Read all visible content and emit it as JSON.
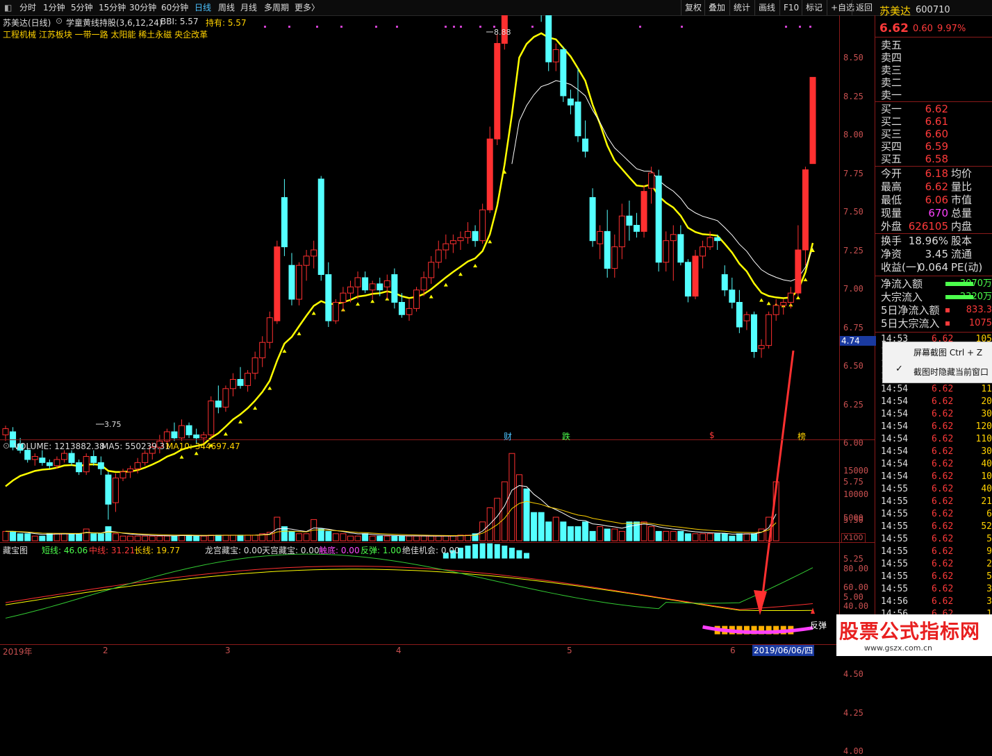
{
  "toolbar": {
    "left": [
      "分时",
      "1分钟",
      "5分钟",
      "15分钟",
      "30分钟",
      "60分钟",
      "日线",
      "周线",
      "月线",
      "多周期",
      "更多〉"
    ],
    "active": "日线",
    "right": [
      "复权",
      "叠加",
      "统计",
      "画线",
      "F10",
      "标记",
      "+自选",
      "返回"
    ]
  },
  "chart_header": {
    "stock": "苏美达(日线)",
    "indicator": "学童黄线持股(3,6,12,24)",
    "bbi": "BBI: 5.57",
    "hold": "持有: 5.57",
    "tags": "工程机械 江苏板块 一带一路 太阳能 稀土永磁 央企改革"
  },
  "price_axis": [
    "8.50",
    "8.25",
    "8.00",
    "7.75",
    "7.50",
    "7.25",
    "7.00",
    "6.75",
    "6.50",
    "6.25",
    "6.00",
    "5.75",
    "5.50",
    "5.25",
    "5.00",
    "4.75",
    "4.50",
    "4.25",
    "4.00"
  ],
  "price_marker": "4.74",
  "chart_labels": {
    "high": "8.88",
    "low": "3.75"
  },
  "event_marks": [
    "财",
    "跌",
    "$",
    "榜"
  ],
  "volume_header": {
    "vol": "VOLUME: 1213882.38",
    "ma5": "MA5: 550239.31",
    "ma10": "MA10: 344697.47"
  },
  "volume_axis": [
    "15000",
    "10000",
    "5000"
  ],
  "volume_unit": "X100",
  "ind_header": {
    "title": "藏宝图",
    "short": "短线: 46.06",
    "mid": "中线: 31.21",
    "long": "长线: 19.77",
    "longgong": "龙宫藏宝: 0.00",
    "tiangong": "天宫藏宝: 0.00",
    "chudi": "触底: 0.00",
    "fantan": "反弹: 1.00",
    "jijia": "绝佳机会: 0.00"
  },
  "ind_axis": [
    "80.00",
    "60.00",
    "40.00"
  ],
  "ind_label": "反弹",
  "date_axis": [
    "2019年",
    "2",
    "3",
    "4",
    "5",
    "6"
  ],
  "date_cursor": "2019/06/06/四",
  "quote": {
    "name": "苏美达",
    "code": "600710",
    "price": "6.62",
    "change": "0.60",
    "pct": "9.97%",
    "sell": [
      "卖五",
      "卖四",
      "卖三",
      "卖二",
      "卖一"
    ],
    "buy": [
      [
        "买一",
        "6.62"
      ],
      [
        "买二",
        "6.61"
      ],
      [
        "买三",
        "6.60"
      ],
      [
        "买四",
        "6.59"
      ],
      [
        "买五",
        "6.58"
      ]
    ],
    "stats": [
      [
        "今开",
        "6.18",
        "均价"
      ],
      [
        "最高",
        "6.62",
        "量比"
      ],
      [
        "最低",
        "6.06",
        "市值"
      ],
      [
        "现量",
        "670",
        "总量"
      ],
      [
        "外盘",
        "626105",
        "内盘"
      ]
    ],
    "stats2": [
      [
        "换手",
        "18.96%",
        "股本"
      ],
      [
        "净资",
        "3.45",
        "流通"
      ],
      [
        "收益(一)",
        "0.064",
        "PE(动)"
      ]
    ],
    "flows": [
      [
        "净流入额",
        "-3070万"
      ],
      [
        "大宗流入",
        "-2320万"
      ],
      [
        "5日净流入额",
        "833.3"
      ],
      [
        "5日大宗流入",
        "1075"
      ]
    ]
  },
  "ticks": [
    [
      "14:53",
      "6.62",
      "105"
    ],
    [
      "14:53",
      "6.62",
      ""
    ],
    [
      "14:53",
      "6.62",
      ""
    ],
    [
      "14:54",
      "6.62",
      ""
    ],
    [
      "14:54",
      "6.62",
      "11"
    ],
    [
      "14:54",
      "6.62",
      "20"
    ],
    [
      "14:54",
      "6.62",
      "30"
    ],
    [
      "14:54",
      "6.62",
      "120"
    ],
    [
      "14:54",
      "6.62",
      "110"
    ],
    [
      "14:54",
      "6.62",
      "30"
    ],
    [
      "14:54",
      "6.62",
      "40"
    ],
    [
      "14:54",
      "6.62",
      "10"
    ],
    [
      "14:55",
      "6.62",
      "40"
    ],
    [
      "14:55",
      "6.62",
      "21"
    ],
    [
      "14:55",
      "6.62",
      "6"
    ],
    [
      "14:55",
      "6.62",
      "52"
    ],
    [
      "14:55",
      "6.62",
      "5"
    ],
    [
      "14:55",
      "6.62",
      "9"
    ],
    [
      "14:55",
      "6.62",
      "2"
    ],
    [
      "14:55",
      "6.62",
      "5"
    ],
    [
      "14:55",
      "6.62",
      "3"
    ],
    [
      "14:56",
      "6.62",
      "3"
    ],
    [
      "14:56",
      "6.62",
      "1"
    ]
  ],
  "context_menu": {
    "screenshot": "屏幕截图  Ctrl + Z",
    "hide": "截图时隐藏当前窗口"
  },
  "watermark": "股票公式指标网",
  "watermark_url": "www.gszx.com.cn",
  "chart_data": {
    "type": "candlestick",
    "price_range": [
      3.75,
      8.88
    ],
    "ohlc": [
      [
        4.3,
        4.36,
        4.26,
        4.34
      ],
      [
        4.32,
        4.35,
        4.2,
        4.22
      ],
      [
        4.24,
        4.28,
        4.18,
        4.2
      ],
      [
        4.2,
        4.22,
        4.12,
        4.14
      ],
      [
        4.14,
        4.18,
        4.1,
        4.16
      ],
      [
        4.15,
        4.2,
        4.1,
        4.12
      ],
      [
        4.12,
        4.14,
        4.08,
        4.1
      ],
      [
        4.1,
        4.16,
        4.08,
        4.14
      ],
      [
        4.14,
        4.2,
        4.12,
        4.18
      ],
      [
        4.18,
        4.2,
        4.1,
        4.12
      ],
      [
        4.12,
        4.14,
        4.04,
        4.06
      ],
      [
        4.06,
        4.18,
        4.04,
        4.16
      ],
      [
        4.16,
        4.2,
        4.1,
        4.12
      ],
      [
        4.12,
        4.16,
        4.04,
        4.08
      ],
      [
        4.04,
        4.06,
        3.75,
        3.85
      ],
      [
        3.86,
        4.05,
        3.8,
        4.02
      ],
      [
        4.02,
        4.08,
        4.0,
        4.06
      ],
      [
        4.06,
        4.1,
        4.02,
        4.08
      ],
      [
        4.08,
        4.15,
        4.05,
        4.12
      ],
      [
        4.12,
        4.2,
        4.1,
        4.18
      ],
      [
        4.18,
        4.25,
        4.14,
        4.22
      ],
      [
        4.22,
        4.3,
        4.18,
        4.26
      ],
      [
        4.26,
        4.34,
        4.22,
        4.32
      ],
      [
        4.32,
        4.38,
        4.26,
        4.28
      ],
      [
        4.28,
        4.4,
        4.26,
        4.36
      ],
      [
        4.36,
        4.38,
        4.28,
        4.3
      ],
      [
        4.3,
        4.34,
        4.24,
        4.28
      ],
      [
        4.28,
        4.32,
        4.24,
        4.3
      ],
      [
        4.3,
        4.55,
        4.28,
        4.52
      ],
      [
        4.52,
        4.62,
        4.44,
        4.48
      ],
      [
        4.48,
        4.62,
        4.45,
        4.6
      ],
      [
        4.6,
        4.7,
        4.55,
        4.66
      ],
      [
        4.66,
        4.74,
        4.6,
        4.62
      ],
      [
        4.62,
        4.72,
        4.58,
        4.7
      ],
      [
        4.7,
        4.84,
        4.66,
        4.8
      ],
      [
        4.8,
        4.94,
        4.74,
        4.9
      ],
      [
        4.9,
        5.1,
        4.86,
        5.06
      ],
      [
        5.04,
        5.56,
        5.02,
        5.52
      ],
      [
        5.84,
        5.96,
        5.46,
        5.52
      ],
      [
        5.4,
        5.48,
        5.14,
        5.18
      ],
      [
        5.18,
        5.42,
        5.14,
        5.4
      ],
      [
        5.4,
        5.5,
        5.3,
        5.46
      ],
      [
        5.46,
        5.56,
        5.38,
        5.5
      ],
      [
        5.96,
        5.98,
        5.3,
        5.34
      ],
      [
        5.34,
        5.42,
        5.0,
        5.04
      ],
      [
        5.04,
        5.18,
        5.02,
        5.16
      ],
      [
        5.16,
        5.26,
        5.1,
        5.22
      ],
      [
        5.22,
        5.3,
        5.16,
        5.26
      ],
      [
        5.26,
        5.36,
        5.18,
        5.32
      ],
      [
        5.32,
        5.36,
        5.22,
        5.24
      ],
      [
        5.24,
        5.3,
        5.18,
        5.28
      ],
      [
        5.28,
        5.32,
        5.2,
        5.24
      ],
      [
        5.26,
        5.34,
        5.18,
        5.3
      ],
      [
        5.34,
        5.38,
        5.12,
        5.16
      ],
      [
        5.16,
        5.22,
        5.06,
        5.08
      ],
      [
        5.08,
        5.18,
        5.04,
        5.12
      ],
      [
        5.12,
        5.26,
        5.1,
        5.24
      ],
      [
        5.24,
        5.36,
        5.2,
        5.32
      ],
      [
        5.32,
        5.46,
        5.28,
        5.42
      ],
      [
        5.42,
        5.56,
        5.38,
        5.5
      ],
      [
        5.5,
        5.6,
        5.44,
        5.54
      ],
      [
        5.54,
        5.6,
        5.48,
        5.56
      ],
      [
        5.56,
        5.62,
        5.5,
        5.58
      ],
      [
        5.58,
        5.68,
        5.54,
        5.62
      ],
      [
        5.62,
        5.66,
        5.52,
        5.56
      ],
      [
        5.56,
        5.8,
        5.54,
        5.76
      ],
      [
        5.76,
        6.3,
        5.74,
        6.22
      ],
      [
        6.22,
        6.9,
        6.18,
        6.84
      ],
      [
        6.84,
        7.66,
        6.8,
        7.56
      ],
      [
        7.56,
        8.32,
        7.4,
        8.22
      ],
      [
        8.22,
        8.88,
        8.16,
        8.84
      ],
      [
        7.72,
        7.9,
        7.32,
        7.34
      ],
      [
        7.34,
        7.4,
        7.1,
        7.14
      ],
      [
        7.16,
        7.24,
        6.98,
        7.04
      ],
      [
        7.04,
        7.14,
        6.66,
        6.72
      ],
      [
        6.72,
        6.84,
        6.66,
        6.8
      ],
      [
        6.8,
        6.82,
        6.46,
        6.5
      ],
      [
        6.48,
        6.54,
        6.38,
        6.44
      ],
      [
        6.46,
        6.68,
        6.2,
        6.24
      ],
      [
        6.22,
        6.34,
        6.1,
        6.14
      ],
      [
        5.84,
        5.9,
        5.52,
        5.56
      ],
      [
        5.54,
        5.66,
        5.44,
        5.62
      ],
      [
        5.62,
        5.76,
        5.32,
        5.38
      ],
      [
        5.38,
        5.6,
        5.32,
        5.52
      ],
      [
        5.52,
        5.8,
        5.44,
        5.72
      ],
      [
        5.72,
        5.82,
        5.56,
        5.66
      ],
      [
        5.66,
        5.74,
        5.58,
        5.62
      ],
      [
        5.62,
        5.92,
        5.58,
        5.88
      ],
      [
        5.9,
        6.04,
        5.8,
        6.0
      ],
      [
        5.98,
        6.02,
        5.36,
        5.42
      ],
      [
        5.42,
        5.62,
        5.36,
        5.56
      ],
      [
        5.56,
        5.66,
        5.3,
        5.6
      ],
      [
        5.6,
        5.66,
        5.4,
        5.42
      ],
      [
        5.42,
        5.44,
        5.16,
        5.2
      ],
      [
        5.2,
        5.5,
        5.18,
        5.46
      ],
      [
        5.46,
        5.56,
        5.38,
        5.52
      ],
      [
        5.52,
        5.62,
        5.5,
        5.58
      ],
      [
        5.58,
        5.6,
        5.5,
        5.56
      ],
      [
        5.34,
        5.4,
        5.2,
        5.24
      ],
      [
        5.24,
        5.32,
        5.12,
        5.16
      ],
      [
        5.16,
        5.24,
        4.96,
        5.0
      ],
      [
        5.04,
        5.1,
        4.98,
        5.08
      ],
      [
        5.08,
        5.1,
        4.8,
        4.84
      ],
      [
        4.86,
        4.92,
        4.8,
        4.88
      ],
      [
        4.88,
        5.1,
        4.86,
        5.08
      ],
      [
        5.08,
        5.18,
        5.04,
        5.14
      ],
      [
        5.14,
        5.18,
        5.08,
        5.16
      ],
      [
        5.16,
        5.26,
        5.12,
        5.22
      ],
      [
        5.22,
        5.66,
        5.2,
        5.5
      ],
      [
        5.5,
        6.04,
        5.4,
        6.02
      ],
      [
        6.06,
        6.62,
        6.06,
        6.62
      ]
    ],
    "bbi_start": [
      3.9,
      4.2
    ],
    "volume": [
      2,
      2,
      1.5,
      1.5,
      1,
      1,
      1.5,
      1.5,
      1.5,
      1.5,
      1.5,
      2.5,
      1.5,
      1.5,
      3,
      1.5,
      1,
      1,
      1,
      1,
      1,
      1,
      1,
      1,
      1.2,
      1.2,
      1,
      1,
      1.2,
      1.2,
      1.2,
      1.2,
      1.2,
      1.2,
      1.2,
      1.5,
      1.8,
      5,
      3,
      2,
      1.5,
      1.5,
      4.5,
      2.5,
      2,
      1.5,
      1.5,
      1,
      1,
      1.5,
      1,
      1,
      1,
      1,
      1,
      1,
      1,
      1,
      1,
      1,
      1,
      1,
      1.2,
      1.2,
      1.5,
      4,
      7,
      9,
      12.5,
      18.5,
      14,
      11,
      6,
      6,
      4,
      5,
      4,
      3,
      3,
      4,
      2,
      3,
      2.5,
      2.5,
      2,
      4,
      4,
      4,
      3,
      2,
      2,
      2,
      2,
      1.5,
      1.5,
      1.5,
      1.5,
      1.5,
      1.5,
      1,
      1.5,
      1.5,
      1.5,
      2.5,
      5,
      12.5
    ]
  }
}
